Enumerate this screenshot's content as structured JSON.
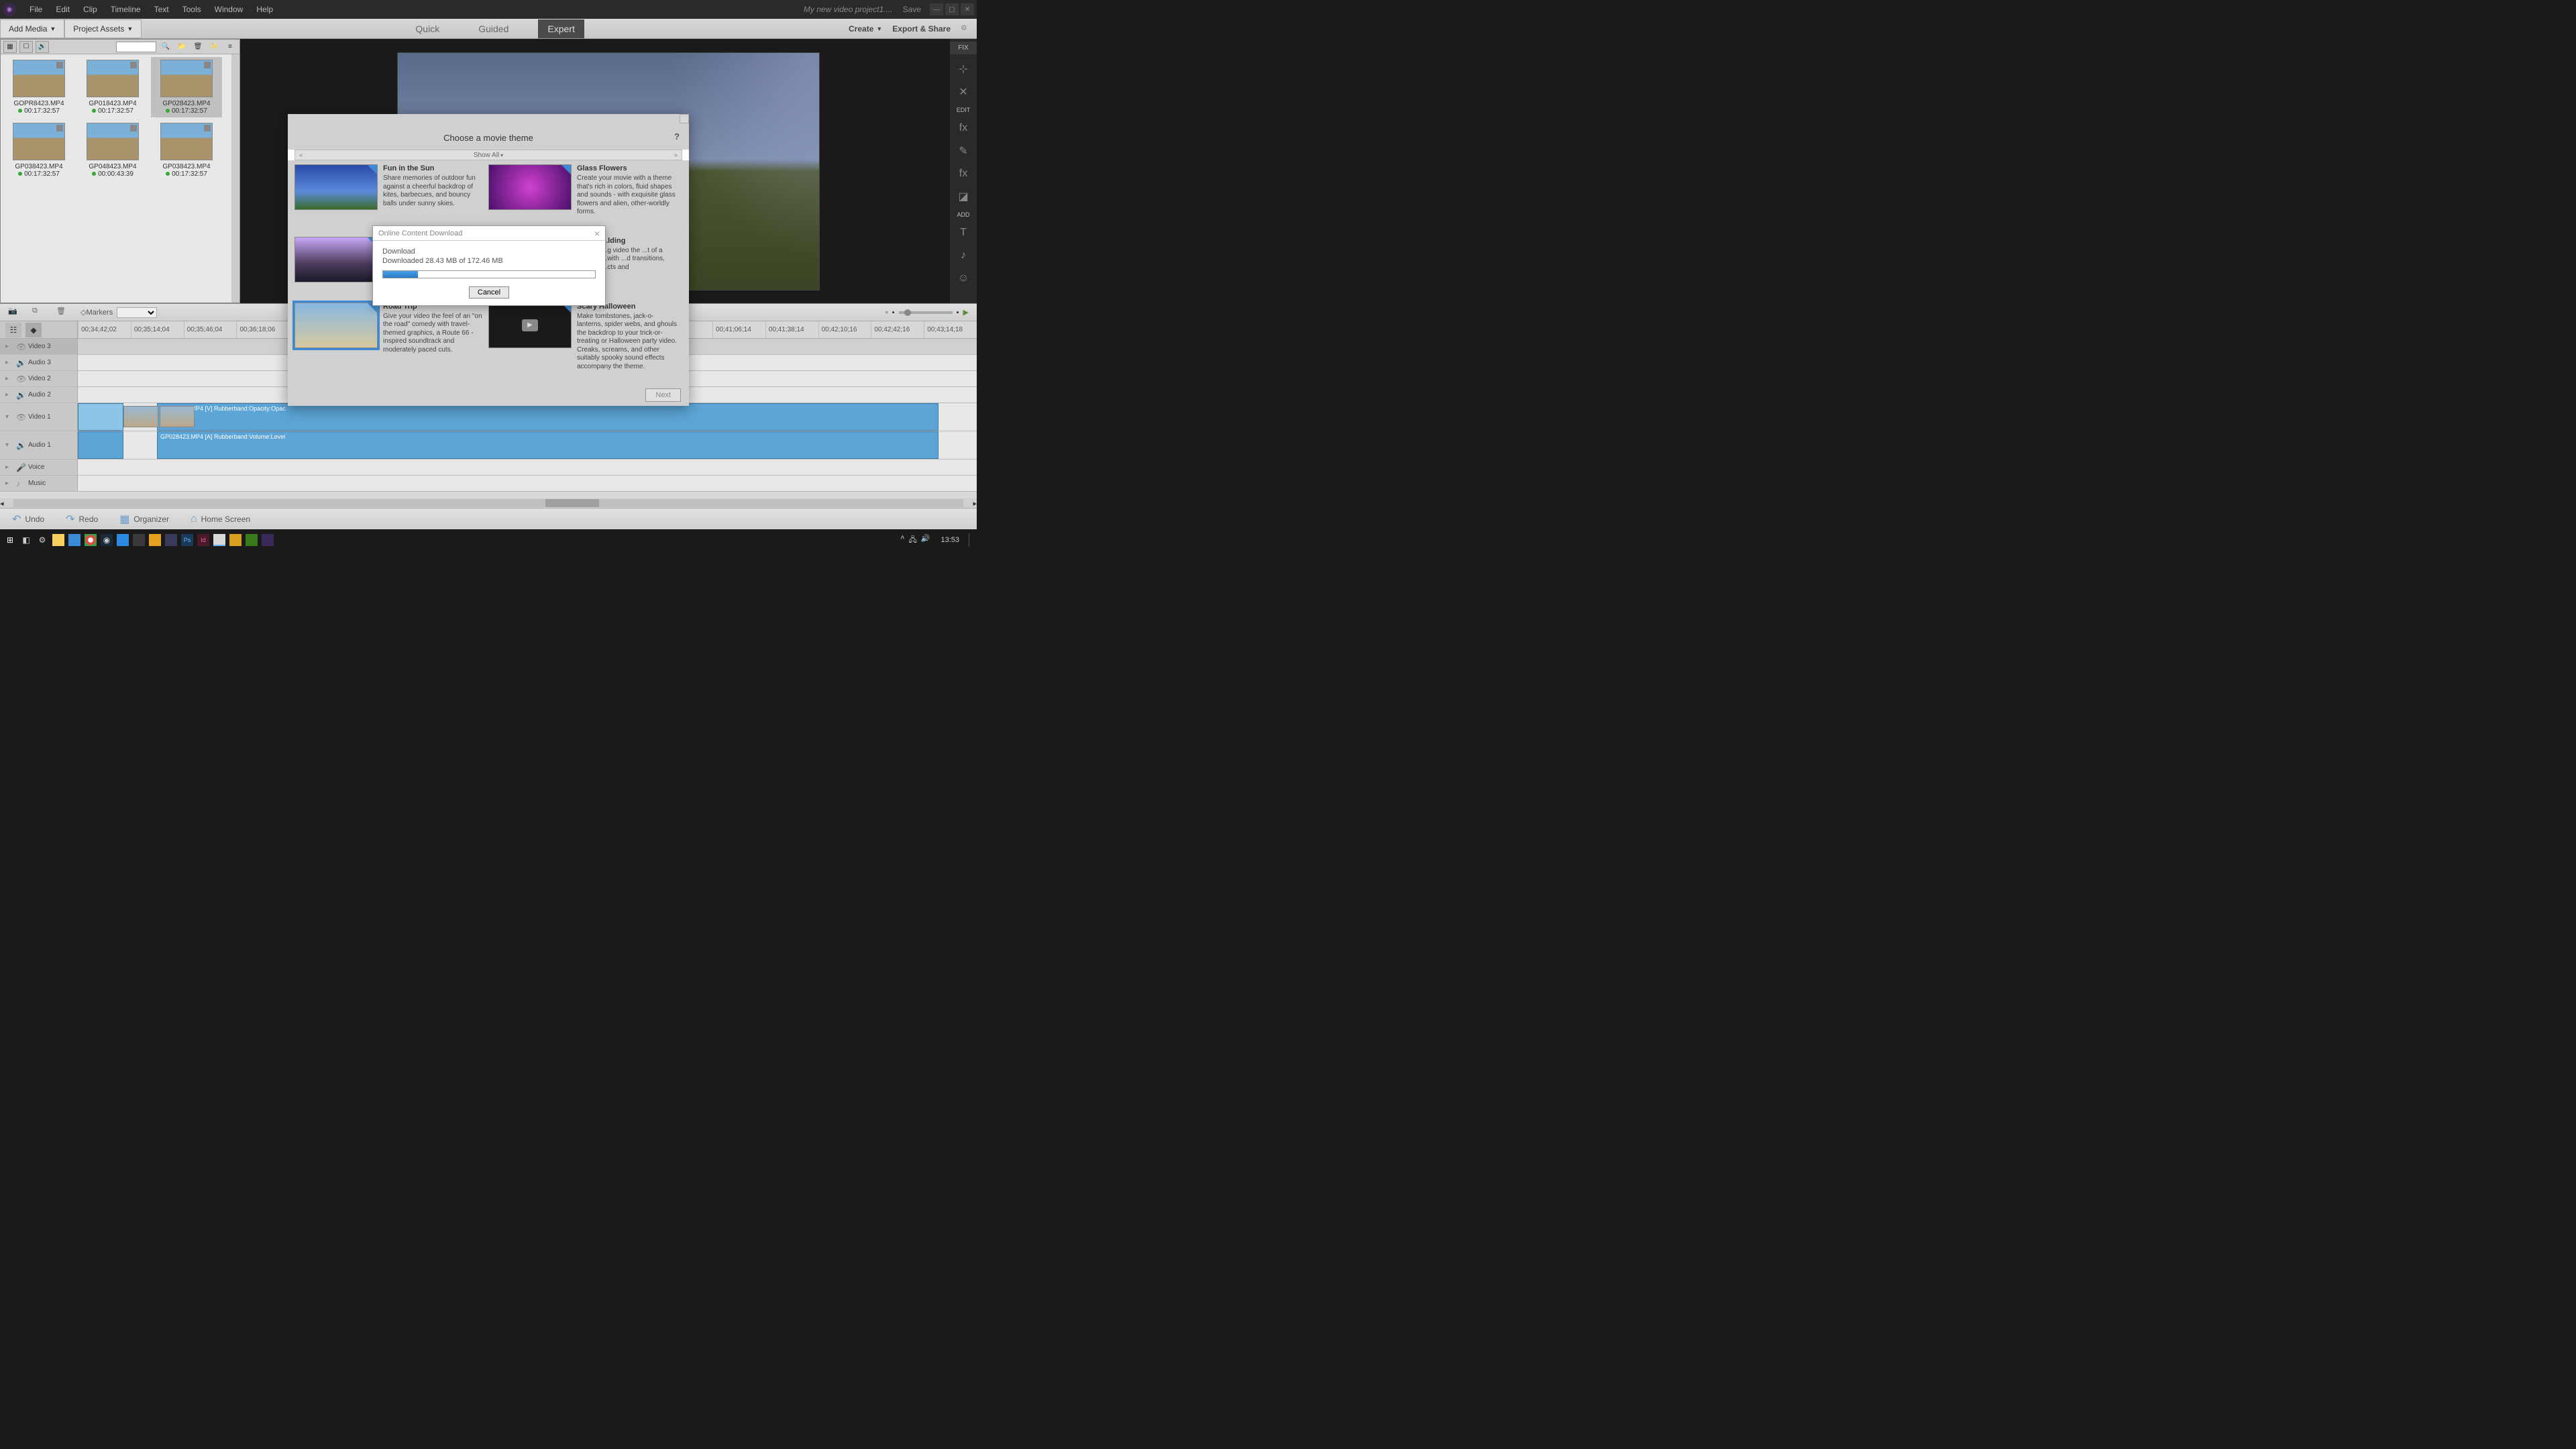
{
  "menubar": {
    "items": [
      "File",
      "Edit",
      "Clip",
      "Timeline",
      "Text",
      "Tools",
      "Window",
      "Help"
    ],
    "project_title": "My new video project1....",
    "save": "Save"
  },
  "toolbar": {
    "add_media": "Add Media",
    "project_assets": "Project Assets",
    "tabs": {
      "quick": "Quick",
      "guided": "Guided",
      "expert": "Expert"
    },
    "create": "Create",
    "export": "Export & Share"
  },
  "sidebar_right": {
    "fix": "FIX",
    "edit": "EDIT",
    "add": "ADD"
  },
  "assets": {
    "items": [
      {
        "name": "GOPR8423.MP4",
        "time": "00:17:32:57"
      },
      {
        "name": "GP018423.MP4",
        "time": "00:17:32:57"
      },
      {
        "name": "GP028423.MP4",
        "time": "00:17:32:57",
        "selected": true
      },
      {
        "name": "GP038423.MP4",
        "time": "00:17:32:57"
      },
      {
        "name": "GP048423.MP4",
        "time": "00:00:43:39"
      },
      {
        "name": "GP038423.MP4",
        "time": "00:17:32:57"
      }
    ]
  },
  "timeline": {
    "markers_label": "Markers",
    "ticks": [
      "00;34;42;02",
      "00;35;14;04",
      "00;35;46;04",
      "00;36;18;06",
      "",
      "",
      "",
      "",
      "",
      "",
      "",
      "",
      "00;41;06;14",
      "00;41;38;14",
      "00;42;10;16",
      "00;42;42;16",
      "00;43;14;18"
    ],
    "tracks": {
      "video3": "Video 3",
      "audio3": "Audio 3",
      "video2": "Video 2",
      "audio2": "Audio 2",
      "video1": "Video 1",
      "audio1": "Audio 1",
      "voice": "Voice",
      "music": "Music"
    },
    "clip_v": "GP028423.MP4 [V] Rubberband:Opacity:Opac",
    "clip_a": "GP028423.MP4 [A] Rubberband:Volume:Level"
  },
  "statusbar": {
    "undo": "Undo",
    "redo": "Redo",
    "organizer": "Organizer",
    "home": "Home Screen"
  },
  "taskbar": {
    "time": "13:53"
  },
  "theme_dialog": {
    "title": "Choose a movie theme",
    "filter": "Show All",
    "next": "Next",
    "themes": [
      {
        "title": "Fun in the Sun",
        "desc": "Share memories of outdoor fun against a cheerful backdrop of kites, barbecues, and bouncy balls under sunny skies.",
        "cls": "th-sun"
      },
      {
        "title": "Glass Flowers",
        "desc": "Create your movie with a theme that's rich in colors, fluid shapes and sounds - with exquisite glass flowers and alien, other-worldly forms.",
        "cls": "th-glass"
      },
      {
        "title": "",
        "desc": "",
        "cls": "th-mountain",
        "obscured": true
      },
      {
        "title": "...lding",
        "desc": "...g video the ...t of a ...with ...d transitions, ...cts and",
        "cls": "",
        "obscured": true,
        "right": true
      },
      {
        "title": "Road Trip",
        "desc": "Give your video the feel of an \"on the road\" comedy with travel-themed graphics, a Route 66 - inspired soundtrack and moderately paced cuts.",
        "cls": "th-road",
        "selected": true
      },
      {
        "title": "Scary  Halloween",
        "desc": "Make tombstones, jack-o-lanterns, spider webs, and ghouls the backdrop to your trick-or-treating or Halloween party video. Creaks, screams, and other suitably spooky sound effects accompany the theme.",
        "cls": "th-halloween"
      }
    ]
  },
  "download": {
    "title": "Online Content Download",
    "label": "Download",
    "status": "Downloaded 28.43 MB of 172.46 MB",
    "cancel": "Cancel"
  }
}
